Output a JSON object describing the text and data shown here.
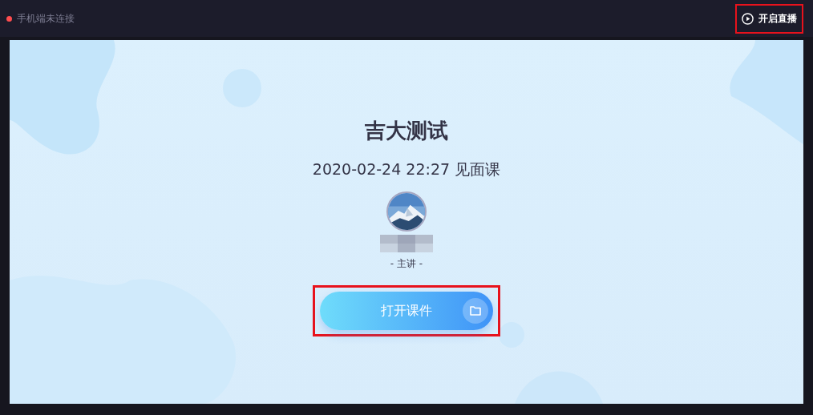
{
  "status": {
    "text": "手机端未连接",
    "connected": false
  },
  "live_button": {
    "label": "开启直播"
  },
  "course": {
    "title": "吉大测试",
    "subtitle": "2020-02-24 22:27 见面课",
    "role": "- 主讲 -"
  },
  "open_button": {
    "label": "打开课件"
  }
}
